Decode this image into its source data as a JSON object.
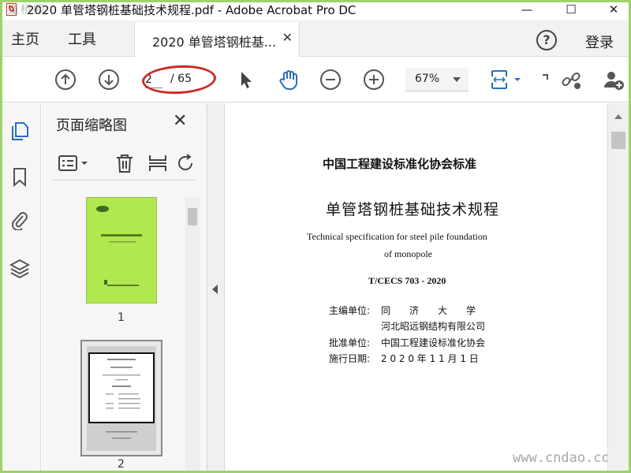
{
  "window": {
    "title": "2020 单管塔钢桩基础技术规程.pdf - Adobe Acrobat Pro DC",
    "watermark_top": "道桥网",
    "minimize": "—",
    "maximize": "☐",
    "close": "✕"
  },
  "menu": {
    "home": "主页",
    "tools": "工具",
    "tab_label": "2020 单管塔钢桩基...",
    "help": "?",
    "login": "登录"
  },
  "toolbar": {
    "current_page": "2",
    "total_pages": "/ 65",
    "zoom": "67%"
  },
  "panel": {
    "title": "页面缩略图",
    "thumbnails": [
      {
        "page": "1"
      },
      {
        "page": "2"
      }
    ]
  },
  "document": {
    "heading": "中国工程建设标准化协会标准",
    "title": "单管塔钢桩基础技术规程",
    "english_line1": "Technical specification for steel pile foundation",
    "english_line2": "of monopole",
    "code": "T/CECS 703 - 2020",
    "meta": [
      {
        "label": "主编单位:",
        "value": "同　　济　　大　　学"
      },
      {
        "label": "",
        "value": "河北昭远钢结构有限公司"
      },
      {
        "label": "批准单位:",
        "value": "中国工程建设标准化协会"
      },
      {
        "label": "施行日期:",
        "value": "2 0 2 0 年 1 1 月 1 日"
      }
    ]
  },
  "watermark_bottom": "www.cndao.com",
  "colors": {
    "accent_blue": "#2a6ebd",
    "thumb1_green": "#b2e84f",
    "annotation_red": "#cc2a2a",
    "frame_green": "#9ed26a"
  }
}
